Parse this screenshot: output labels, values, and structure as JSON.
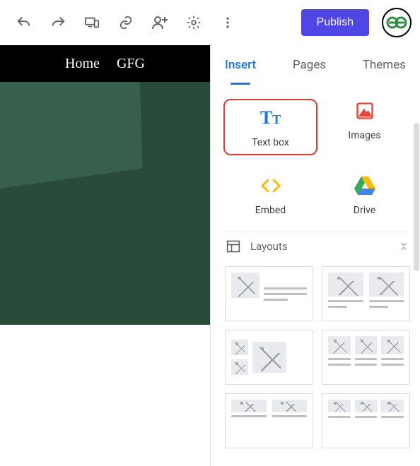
{
  "toolbar": {
    "publish_label": "Publish"
  },
  "nav": {
    "home": "Home",
    "gfg": "GFG"
  },
  "tabs": {
    "insert": "Insert",
    "pages": "Pages",
    "themes": "Themes"
  },
  "insert": {
    "text_box": "Text box",
    "images": "Images",
    "embed": "Embed",
    "drive": "Drive"
  },
  "sections": {
    "layouts": "Layouts"
  }
}
